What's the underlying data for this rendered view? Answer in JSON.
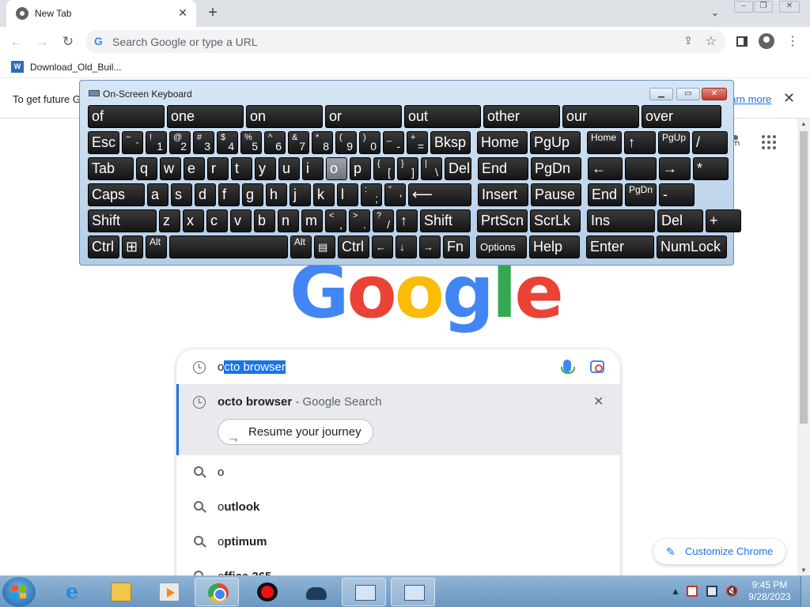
{
  "browser": {
    "tab_title": "New Tab",
    "omnibox_placeholder": "Search Google or type a URL",
    "bookmark_label": "Download_Old_Buil...",
    "infobar_message": "To get future G",
    "infobar_link": "earn more"
  },
  "ntp": {
    "logo": [
      "G",
      "o",
      "o",
      "g",
      "l",
      "e"
    ],
    "input_typed": "o",
    "input_autocomplete": "cto browser",
    "active_suggestion_bold": "octo browser",
    "active_suggestion_rest": " - Google Search",
    "journey_chip": "Resume your journey",
    "suggestions": [
      {
        "prefix": "o",
        "rest": ""
      },
      {
        "prefix": "o",
        "rest": "utlook"
      },
      {
        "prefix": "o",
        "rest": "ptimum"
      },
      {
        "prefix": "o",
        "rest": "ffice 365"
      }
    ],
    "customize_label": "Customize Chrome"
  },
  "osk": {
    "title": "On-Screen Keyboard",
    "pressed_key": "o",
    "rows": [
      [
        {
          "t": "of",
          "w": 97
        },
        {
          "t": "one",
          "w": 97
        },
        {
          "t": "on",
          "w": 97
        },
        {
          "t": "or",
          "w": 97
        },
        {
          "t": "out",
          "w": 97
        },
        {
          "t": "other",
          "w": 97
        },
        {
          "t": "our",
          "w": 97
        },
        {
          "t": "over",
          "w": 101
        }
      ],
      [
        {
          "t": "Esc",
          "w": 40
        },
        {
          "u": "~",
          "d": "`",
          "w": 27
        },
        {
          "u": "!",
          "d": "1",
          "w": 27
        },
        {
          "u": "@",
          "d": "2",
          "w": 27
        },
        {
          "u": "#",
          "d": "3",
          "w": 27
        },
        {
          "u": "$",
          "d": "4",
          "w": 27
        },
        {
          "u": "%",
          "d": "5",
          "w": 27
        },
        {
          "u": "^",
          "d": "6",
          "w": 27
        },
        {
          "u": "&",
          "d": "7",
          "w": 27
        },
        {
          "u": "*",
          "d": "8",
          "w": 27
        },
        {
          "u": "(",
          "d": "9",
          "w": 27
        },
        {
          "u": ")",
          "d": "0",
          "w": 27
        },
        {
          "u": "_",
          "d": "-",
          "w": 27
        },
        {
          "u": "+",
          "d": "=",
          "w": 27
        },
        {
          "t": "Bksp",
          "w": 51
        },
        {
          "gap": 5
        },
        {
          "t": "Home",
          "w": 64
        },
        {
          "t": "PgUp",
          "w": 64
        },
        {
          "gap": 5
        },
        {
          "t": "Home",
          "w": 44,
          "c": "tiny"
        },
        {
          "t": "↑",
          "w": 40
        },
        {
          "t": "PgUp",
          "w": 40,
          "c": "tiny"
        },
        {
          "t": "/",
          "w": 45
        }
      ],
      [
        {
          "t": "Tab",
          "w": 58
        },
        {
          "t": "q",
          "w": 27
        },
        {
          "t": "w",
          "w": 27
        },
        {
          "t": "e",
          "w": 27
        },
        {
          "t": "r",
          "w": 27
        },
        {
          "t": "t",
          "w": 27
        },
        {
          "t": "y",
          "w": 27
        },
        {
          "t": "u",
          "w": 27
        },
        {
          "t": "i",
          "w": 27
        },
        {
          "t": "o",
          "w": 27,
          "p": true
        },
        {
          "t": "p",
          "w": 27
        },
        {
          "u": "{",
          "d": "[",
          "w": 27
        },
        {
          "u": "}",
          "d": "]",
          "w": 27
        },
        {
          "u": "|",
          "d": "\\",
          "w": 27
        },
        {
          "t": "Del",
          "w": 34
        },
        {
          "gap": 5
        },
        {
          "t": "End",
          "w": 64
        },
        {
          "t": "PgDn",
          "w": 64
        },
        {
          "gap": 5
        },
        {
          "t": "←",
          "w": 44
        },
        {
          "t": "",
          "w": 40
        },
        {
          "t": "→",
          "w": 40
        },
        {
          "t": "*",
          "w": 45
        }
      ],
      [
        {
          "t": "Caps",
          "w": 72
        },
        {
          "t": "a",
          "w": 27
        },
        {
          "t": "s",
          "w": 27
        },
        {
          "t": "d",
          "w": 27
        },
        {
          "t": "f",
          "w": 27
        },
        {
          "t": "g",
          "w": 27
        },
        {
          "t": "h",
          "w": 27
        },
        {
          "t": "j",
          "w": 27
        },
        {
          "t": "k",
          "w": 27
        },
        {
          "t": "l",
          "w": 27
        },
        {
          "u": ":",
          "d": ";",
          "w": 27
        },
        {
          "u": "\"",
          "d": "'",
          "w": 27
        },
        {
          "t": "⟵",
          "w": 80
        },
        {
          "gap": 5
        },
        {
          "t": "Insert",
          "w": 64
        },
        {
          "t": "Pause",
          "w": 64
        },
        {
          "gap": 5
        },
        {
          "t": "End",
          "w": 44
        },
        {
          "t": "PgDn",
          "w": 40,
          "c": "tiny"
        },
        {
          "t": "-",
          "w": 45
        }
      ],
      [
        {
          "t": "Shift",
          "w": 87
        },
        {
          "t": "z",
          "w": 27
        },
        {
          "t": "x",
          "w": 27
        },
        {
          "t": "c",
          "w": 27
        },
        {
          "t": "v",
          "w": 27
        },
        {
          "t": "b",
          "w": 27
        },
        {
          "t": "n",
          "w": 27
        },
        {
          "t": "m",
          "w": 27
        },
        {
          "u": "<",
          "d": ",",
          "w": 27
        },
        {
          "u": ">",
          "d": ".",
          "w": 27
        },
        {
          "u": "?",
          "d": "/",
          "w": 27
        },
        {
          "t": "↑",
          "w": 27
        },
        {
          "t": "Shift",
          "w": 64
        },
        {
          "gap": 5
        },
        {
          "t": "PrtScn",
          "w": 64
        },
        {
          "t": "ScrLk",
          "w": 64
        },
        {
          "gap": 5
        },
        {
          "t": "Ins",
          "w": 86
        },
        {
          "t": "Del",
          "w": 58
        },
        {
          "t": "+",
          "w": 45
        }
      ],
      [
        {
          "t": "Ctrl",
          "w": 40
        },
        {
          "t": "⊞",
          "w": 27
        },
        {
          "t": "Alt",
          "w": 27,
          "c": "tiny"
        },
        {
          "t": "",
          "w": 150
        },
        {
          "t": "Alt",
          "w": 27,
          "c": "tiny"
        },
        {
          "t": "▤",
          "w": 27,
          "c": "small"
        },
        {
          "t": "Ctrl",
          "w": 40
        },
        {
          "t": "←",
          "w": 27,
          "c": "small"
        },
        {
          "t": "↓",
          "w": 27,
          "c": "small"
        },
        {
          "t": "→",
          "w": 27,
          "c": "small"
        },
        {
          "t": "Fn",
          "w": 34
        },
        {
          "gap": 5
        },
        {
          "t": "Options",
          "w": 64,
          "c": "small"
        },
        {
          "t": "Help",
          "w": 64
        },
        {
          "gap": 5
        },
        {
          "t": "Enter",
          "w": 86
        },
        {
          "t": "NumLock",
          "w": 89
        }
      ]
    ]
  },
  "taskbar": {
    "time": "9:45 PM",
    "date": "9/28/2023",
    "apps": [
      "ie",
      "explorer",
      "media",
      "chrome",
      "rec",
      "car",
      "osk-tool",
      "kbd"
    ]
  },
  "colors": {
    "google_blue": "#4285f4",
    "google_red": "#ea4335",
    "google_yellow": "#fbbc05",
    "google_green": "#34a853",
    "link": "#1a73e8"
  }
}
